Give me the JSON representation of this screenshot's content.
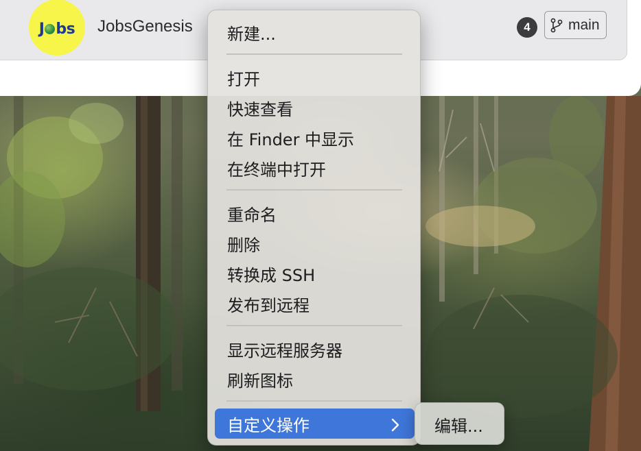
{
  "app": {
    "name": "JobsGenesis",
    "logo_text_j": "J",
    "logo_text_rest": "bs",
    "badge_count": "4",
    "branch_label": "main"
  },
  "context_menu": {
    "groups": [
      [
        "新建..."
      ],
      [
        "打开",
        "快速查看",
        "在 Finder 中显示",
        "在终端中打开"
      ],
      [
        "重命名",
        "删除",
        "转换成 SSH",
        "发布到远程"
      ],
      [
        "显示远程服务器",
        "刷新图标"
      ]
    ],
    "highlighted_item": "自定义操作",
    "submenu": {
      "items": [
        "编辑..."
      ]
    }
  },
  "colors": {
    "highlight": "#3f76d9",
    "logo_background": "#f7f54a",
    "logo_text": "#1f3b8e"
  },
  "icons": {
    "branch": "git-branch-icon",
    "submenu_arrow": "chevron-right-icon"
  }
}
